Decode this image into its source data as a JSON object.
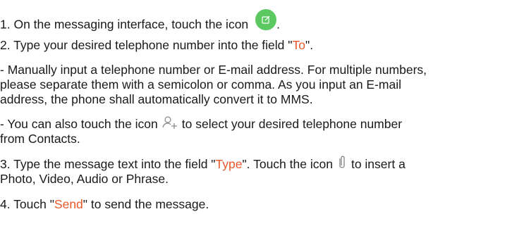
{
  "steps": {
    "s1": {
      "pre": "1. On the messaging interface, touch the icon",
      "post": "."
    },
    "s2": {
      "pre": "2. Type your desired telephone number into the field \"",
      "hl": "To",
      "post": "\"."
    },
    "s2a": {
      "lines": [
        "- Manually input a telephone number or E-mail address. For multiple numbers,",
        "please separate them with a semicolon or comma. As you input an E-mail",
        "address, the phone shall automatically convert it to MMS."
      ]
    },
    "s2b": {
      "pre": "- You can also touch the icon",
      "post": "to select your desired telephone number",
      "line2": "from Contacts."
    },
    "s3": {
      "pre": "3. Type the message text into the field \"",
      "hl": "Type",
      "mid": "\". Touch the icon",
      "post": "to insert a",
      "line2": "Photo, Video, Audio or Phrase."
    },
    "s4": {
      "pre": "4. Touch \"",
      "hl": "Send",
      "post": "\" to send the message."
    }
  },
  "icons": {
    "compose": "compose-message-icon",
    "contact": "add-contact-icon",
    "attach": "paperclip-icon"
  },
  "colors": {
    "highlight": "#e8572a",
    "compose_bg": "#5cc861",
    "text": "#1a1a1a"
  }
}
